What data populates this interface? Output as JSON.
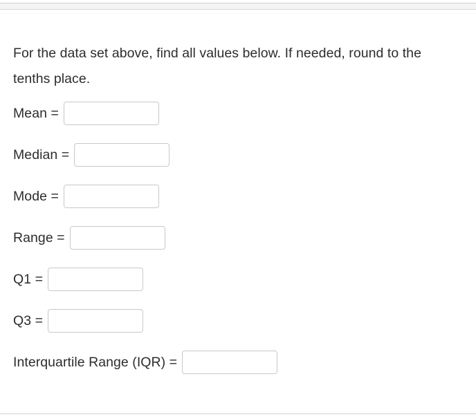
{
  "page": {
    "instruction": "For the data set above, find all values below. If needed, round to the tenths place."
  },
  "answers": {
    "fields": [
      {
        "label": "Mean =",
        "value": "",
        "placeholder": ""
      },
      {
        "label": "Median =",
        "value": "",
        "placeholder": ""
      },
      {
        "label": "Mode =",
        "value": "",
        "placeholder": ""
      },
      {
        "label": "Range =",
        "value": "",
        "placeholder": ""
      },
      {
        "label": "Q1 =",
        "value": "",
        "placeholder": ""
      },
      {
        "label": "Q3 =",
        "value": "",
        "placeholder": ""
      },
      {
        "label": "Interquartile Range (IQR) =",
        "value": "",
        "placeholder": ""
      }
    ]
  },
  "colors": {
    "text": "#2d2d2d",
    "input_border": "#c8c8c8",
    "strip_background": "#f4f4f5",
    "rule": "#d4d4d4",
    "page_background": "#ffffff"
  }
}
